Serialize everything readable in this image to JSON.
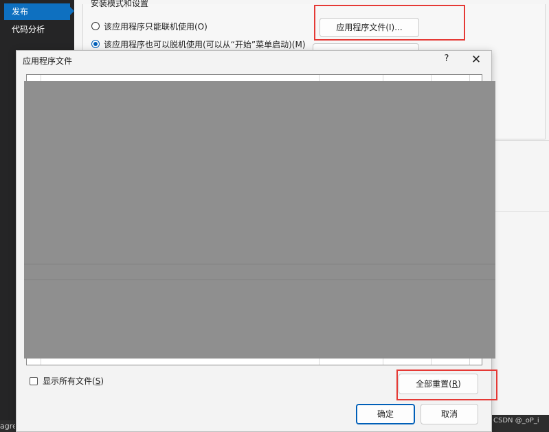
{
  "sidebar": {
    "items": [
      {
        "label": "发布",
        "active": true
      },
      {
        "label": "代码分析",
        "active": false
      }
    ],
    "status_fragment": "agre"
  },
  "panel": {
    "group_title": "安装模式和设置",
    "radio_online": "该应用程序只能联机使用(O)",
    "radio_offline": "该应用程序也可以脱机使用(可以从“开始”菜单启动)(M)",
    "app_files_button": "应用程序文件(I)...",
    "watermark": "CSDN @_oP_i"
  },
  "dialog": {
    "title": "应用程序文件",
    "help_glyph": "?",
    "close_glyph": "✕",
    "show_all_files_label": "显示所有文件",
    "show_all_files_key": "S",
    "reset_all_label": "全部重置",
    "reset_all_key": "R",
    "ok_label": "确定",
    "cancel_label": "取消"
  },
  "colors": {
    "accent": "#0e70c0",
    "highlight_box": "#e53935",
    "redaction": "#8f8f8f"
  }
}
